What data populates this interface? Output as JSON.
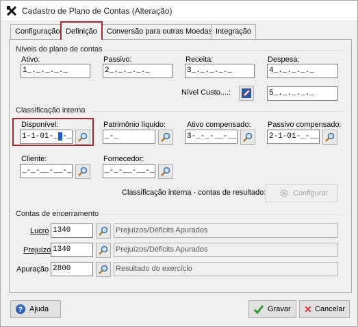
{
  "window": {
    "title": "Cadastro de Plano de Contas (Alteração)"
  },
  "tabs": [
    {
      "label": "Configuração"
    },
    {
      "label": "Definição"
    },
    {
      "label": "Conversão para outras Moedas"
    },
    {
      "label": "Integração"
    }
  ],
  "niveis": {
    "group_label": "Níveis do plano de contas",
    "ativo": {
      "label": "Ativo:",
      "value": "1_._._._._"
    },
    "passivo": {
      "label": "Passivo:",
      "value": "2_._._._._"
    },
    "receita": {
      "label": "Receita:",
      "value": "3_._._._._"
    },
    "despesa": {
      "label": "Despesa:",
      "value": "4_._._._._"
    },
    "custo": {
      "label": "Nível Custo....:",
      "value": "5_._._._._"
    }
  },
  "classificacao": {
    "group_label": "Classificação interna",
    "disponivel": {
      "label": "Disponível:",
      "value_prefix": "1-1-01-_",
      "value_suffix": "-__"
    },
    "patrimonio": {
      "label": "Patrimônio líquido:",
      "value": "_-_"
    },
    "ativo_comp": {
      "label": "Ativo compensado:",
      "value": "3-_-_-__-__"
    },
    "passivo_comp": {
      "label": "Passivo compensado:",
      "value": "2-1-01-_-__"
    },
    "cliente": {
      "label": "Cliente:",
      "value": "_-_-__-__-__"
    },
    "fornecedor": {
      "label": "Fornecedor:",
      "value": "_-_-__-__-__"
    },
    "resultado_label": "Classificação interna - contas de resultado:",
    "configurar_label": "Configurar"
  },
  "encerramento": {
    "group_label": "Contas de encerramento",
    "lucro": {
      "label": "Lucro",
      "code": "1340",
      "desc": "Prejuízos/Déficits Apurados"
    },
    "prejuizo": {
      "label": "Prejuízo",
      "code": "1340",
      "desc": "Prejuízos/Déficits Apurados"
    },
    "apuracao": {
      "label": "Apuração",
      "code": "2800",
      "desc": "Resultado do exercício"
    }
  },
  "footer": {
    "help_label": "Ajuda",
    "save_label": "Gravar",
    "cancel_label": "Cancelar"
  },
  "colors": {
    "highlight": "#9c2a2e",
    "accent": "#1e5fd0"
  }
}
